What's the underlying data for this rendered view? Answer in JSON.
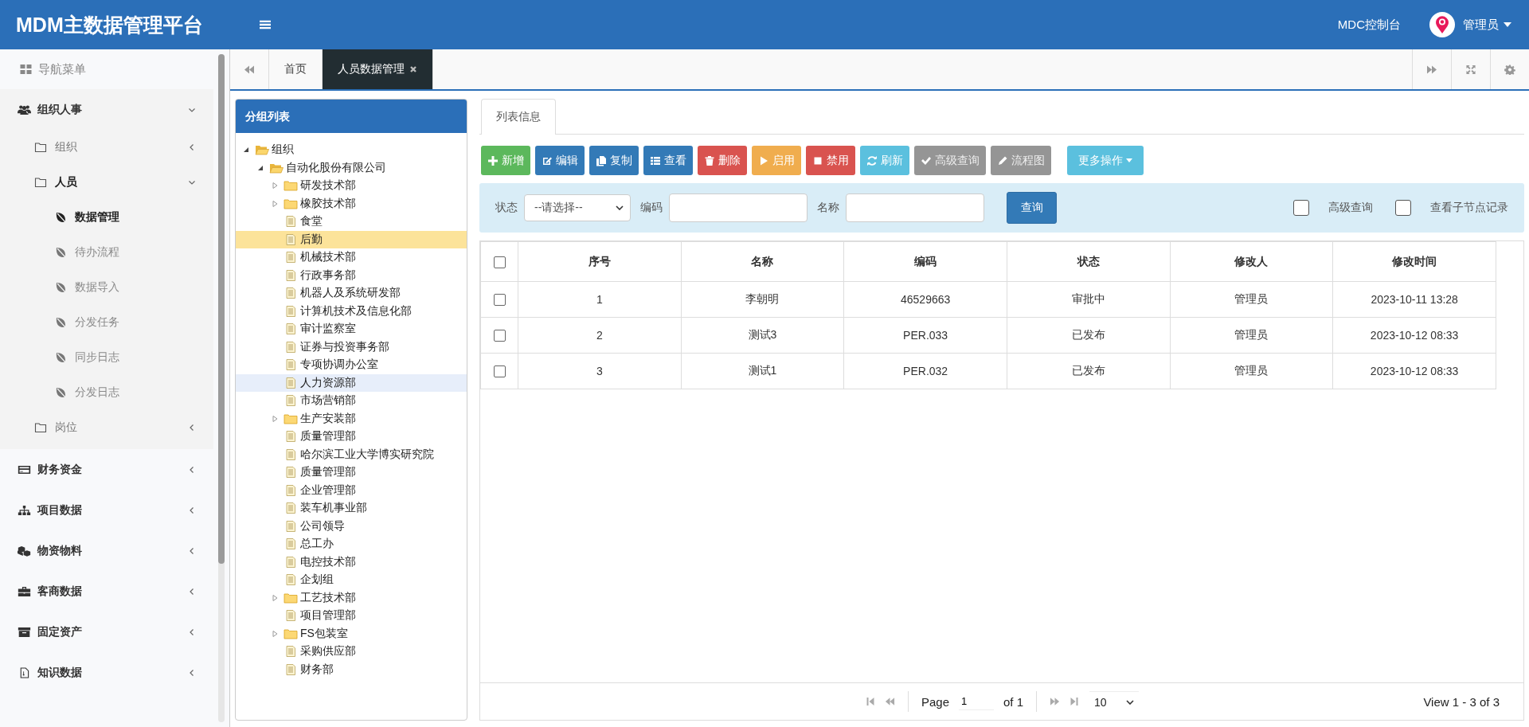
{
  "header": {
    "title": "MDM主数据管理平台",
    "console_link": "MDC控制台",
    "user": "管理员"
  },
  "sidebar": {
    "heading": "导航菜单",
    "menu": [
      {
        "label": "组织人事",
        "expanded": true,
        "children": [
          {
            "label": "组织",
            "expanded": false
          },
          {
            "label": "人员",
            "expanded": true,
            "children": [
              {
                "label": "数据管理",
                "selected": true
              },
              {
                "label": "待办流程",
                "selected": false
              },
              {
                "label": "数据导入",
                "selected": false
              },
              {
                "label": "分发任务",
                "selected": false
              },
              {
                "label": "同步日志",
                "selected": false
              },
              {
                "label": "分发日志",
                "selected": false
              }
            ]
          },
          {
            "label": "岗位",
            "expanded": false
          }
        ]
      },
      {
        "label": "财务资金",
        "expanded": false
      },
      {
        "label": "项目数据",
        "expanded": false
      },
      {
        "label": "物资物料",
        "expanded": false
      },
      {
        "label": "客商数据",
        "expanded": false
      },
      {
        "label": "固定资产",
        "expanded": false
      },
      {
        "label": "知识数据",
        "expanded": false
      }
    ]
  },
  "tabs": [
    {
      "label": "首页",
      "selected": false,
      "closable": false
    },
    {
      "label": "人员数据管理",
      "selected": true,
      "closable": true
    }
  ],
  "tree": {
    "title": "分组列表",
    "nodes": [
      {
        "label": "组织",
        "kind": "folder",
        "expanded": true,
        "selected": false,
        "hovered": false,
        "children": [
          {
            "label": "自动化股份有限公司",
            "kind": "folder",
            "expanded": true,
            "selected": false,
            "hovered": false,
            "children": [
              {
                "label": "研发技术部",
                "kind": "folder",
                "expanded": false,
                "selected": false,
                "hovered": false
              },
              {
                "label": "橡胶技术部",
                "kind": "folder",
                "expanded": false,
                "selected": false,
                "hovered": false
              },
              {
                "label": "食堂",
                "kind": "file",
                "selected": false,
                "hovered": false
              },
              {
                "label": "后勤",
                "kind": "file",
                "selected": true,
                "hovered": false
              },
              {
                "label": "机械技术部",
                "kind": "file",
                "selected": false,
                "hovered": false
              },
              {
                "label": "行政事务部",
                "kind": "file",
                "selected": false,
                "hovered": false
              },
              {
                "label": "机器人及系统研发部",
                "kind": "file",
                "selected": false,
                "hovered": false
              },
              {
                "label": "计算机技术及信息化部",
                "kind": "file",
                "selected": false,
                "hovered": false
              },
              {
                "label": "审计监察室",
                "kind": "file",
                "selected": false,
                "hovered": false
              },
              {
                "label": "证券与投资事务部",
                "kind": "file",
                "selected": false,
                "hovered": false
              },
              {
                "label": "专项协调办公室",
                "kind": "file",
                "selected": false,
                "hovered": false
              },
              {
                "label": "人力资源部",
                "kind": "file",
                "selected": false,
                "hovered": true
              },
              {
                "label": "市场营销部",
                "kind": "file",
                "selected": false,
                "hovered": false
              },
              {
                "label": "生产安装部",
                "kind": "folder",
                "expanded": false,
                "selected": false,
                "hovered": false
              },
              {
                "label": "质量管理部",
                "kind": "file",
                "selected": false,
                "hovered": false
              },
              {
                "label": "哈尔滨工业大学博实研究院",
                "kind": "file",
                "selected": false,
                "hovered": false
              },
              {
                "label": "质量管理部",
                "kind": "file",
                "selected": false,
                "hovered": false
              },
              {
                "label": "企业管理部",
                "kind": "file",
                "selected": false,
                "hovered": false
              },
              {
                "label": "装车机事业部",
                "kind": "file",
                "selected": false,
                "hovered": false
              },
              {
                "label": "公司领导",
                "kind": "file",
                "selected": false,
                "hovered": false
              },
              {
                "label": "总工办",
                "kind": "file",
                "selected": false,
                "hovered": false
              },
              {
                "label": "电控技术部",
                "kind": "file",
                "selected": false,
                "hovered": false
              },
              {
                "label": "企划组",
                "kind": "file",
                "selected": false,
                "hovered": false
              },
              {
                "label": "工艺技术部",
                "kind": "folder",
                "expanded": false,
                "selected": false,
                "hovered": false
              },
              {
                "label": "项目管理部",
                "kind": "file",
                "selected": false,
                "hovered": false
              },
              {
                "label": "FS包装室",
                "kind": "folder",
                "expanded": false,
                "selected": false,
                "hovered": false
              },
              {
                "label": "采购供应部",
                "kind": "file",
                "selected": false,
                "hovered": false
              },
              {
                "label": "财务部",
                "kind": "file",
                "selected": false,
                "hovered": false
              }
            ]
          }
        ]
      }
    ]
  },
  "panel_tabs": [
    {
      "label": "列表信息",
      "selected": true
    }
  ],
  "toolbar": [
    {
      "label": "新增",
      "kind": "button",
      "color": "#5cb85c",
      "disabled": false
    },
    {
      "label": "编辑",
      "kind": "button",
      "color": "#337ab7",
      "disabled": false
    },
    {
      "label": "复制",
      "kind": "button",
      "color": "#337ab7",
      "disabled": false
    },
    {
      "label": "查看",
      "kind": "button",
      "color": "#337ab7",
      "disabled": false
    },
    {
      "label": "删除",
      "kind": "button",
      "color": "#d9534f",
      "disabled": false
    },
    {
      "label": "启用",
      "kind": "button",
      "color": "#f0ad4e",
      "disabled": false
    },
    {
      "label": "禁用",
      "kind": "button",
      "color": "#d9534f",
      "disabled": false
    },
    {
      "label": "刷新",
      "kind": "button",
      "color": "#5bc0de",
      "disabled": false
    },
    {
      "label": "高级查询",
      "kind": "button",
      "color": "#959595",
      "disabled": true
    },
    {
      "label": "流程图",
      "kind": "button",
      "color": "#959595",
      "disabled": true
    },
    {
      "label": "更多操作",
      "kind": "dropdown",
      "color": "#5bc0de",
      "disabled": false
    }
  ],
  "filter": {
    "fields": [
      {
        "label": "状态",
        "kind": "select",
        "value": "--请选择--"
      },
      {
        "label": "编码",
        "kind": "text"
      },
      {
        "label": "名称",
        "kind": "text"
      }
    ],
    "search_button": "查询",
    "options": [
      {
        "label": "高级查询",
        "checked": false
      },
      {
        "label": "查看子节点记录",
        "checked": false
      }
    ]
  },
  "table": {
    "select_all": false,
    "columns": [
      "序号",
      "名称",
      "编码",
      "状态",
      "修改人",
      "修改时间"
    ],
    "rows": [
      {
        "checked": false,
        "cells": [
          "1",
          "李朝明",
          "46529663",
          "审批中",
          "管理员",
          "2023-10-11 13:28"
        ]
      },
      {
        "checked": false,
        "cells": [
          "2",
          "测试3",
          "PER.033",
          "已发布",
          "管理员",
          "2023-10-12 08:33"
        ]
      },
      {
        "checked": false,
        "cells": [
          "3",
          "测试1",
          "PER.032",
          "已发布",
          "管理员",
          "2023-10-12 08:33"
        ]
      }
    ]
  },
  "pager": {
    "page_label": "Page",
    "page": "1",
    "of_label": "of 1",
    "page_size": "10",
    "summary": "View 1 - 3 of 3"
  }
}
